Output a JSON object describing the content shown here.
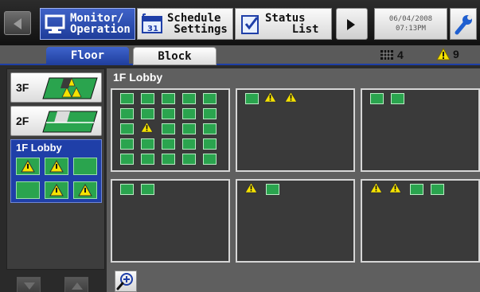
{
  "toolbar": {
    "tabs": [
      {
        "line1": "Monitor/",
        "line2": "Operation",
        "icon": "monitor-icon",
        "active": true
      },
      {
        "line1": "Schedule",
        "line2": " Settings",
        "icon": "calendar-icon",
        "active": false
      },
      {
        "line1": "Status",
        "line2": "    List",
        "icon": "clipboard-icon",
        "active": false
      }
    ],
    "date": "06/04/2008",
    "time": "07:13PM",
    "prev_icon": "left-arrow-icon",
    "next_icon": "right-arrow-icon",
    "settings_icon": "wrench-icon"
  },
  "view_tabs": [
    {
      "label": "Floor",
      "active": true
    },
    {
      "label": "Block",
      "active": false
    }
  ],
  "counts": {
    "groups": "4",
    "alarms": "9",
    "groups_icon": "grid-icon",
    "alarms_icon": "warning-icon"
  },
  "floors": [
    {
      "label": "3F"
    },
    {
      "label": "2F"
    },
    {
      "label": "1F Lobby",
      "selected": true
    }
  ],
  "main": {
    "title": "1F Lobby"
  },
  "colors": {
    "active_tab": "#1f3fa8",
    "unit_green": "#2aa44e",
    "warning_yellow": "#f5e200"
  }
}
